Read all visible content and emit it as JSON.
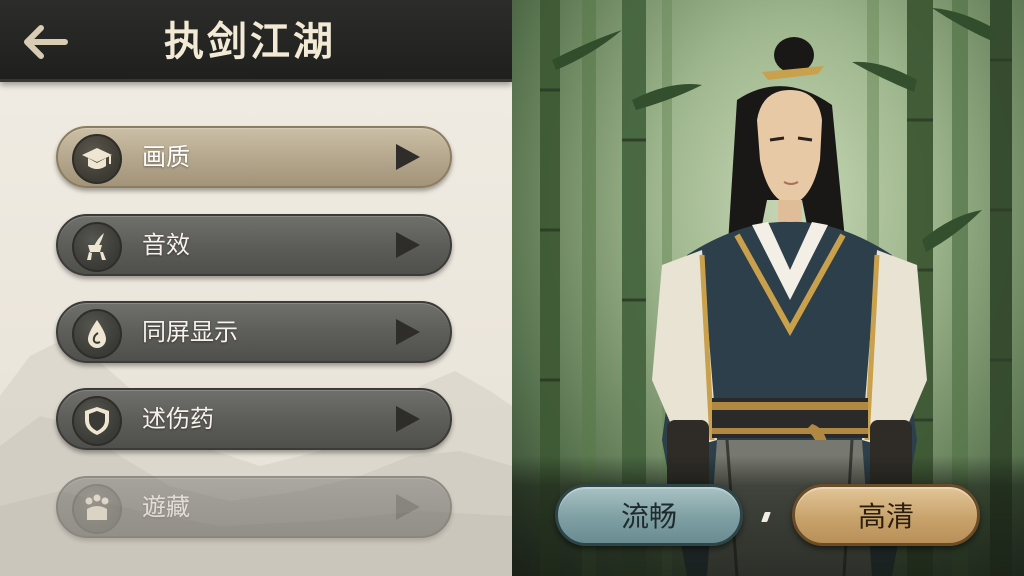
{
  "header": {
    "title": "执剑江湖",
    "back_icon": "back-arrow-icon"
  },
  "menu": {
    "items": [
      {
        "label": "画质",
        "icon": "graduation-cap-icon",
        "state": "active"
      },
      {
        "label": "音效",
        "icon": "speaker-quill-icon",
        "state": "normal"
      },
      {
        "label": "同屏显示",
        "icon": "droplet-icon",
        "state": "normal"
      },
      {
        "label": "述伤药",
        "icon": "shield-icon",
        "state": "normal"
      },
      {
        "label": "遊藏",
        "icon": "paw-icon",
        "state": "faded"
      }
    ]
  },
  "quality": {
    "options": [
      {
        "label": "流畅",
        "selected": false
      },
      {
        "label": "高清",
        "selected": true
      }
    ],
    "separator": "ʼ"
  },
  "colors": {
    "header_bg": "#252523",
    "title_text": "#f3ead6",
    "menu_item": "#5d5d59",
    "menu_item_active": "#b3a68c",
    "btn_smooth": "#7e9fa3",
    "btn_hd": "#c9a36c"
  }
}
